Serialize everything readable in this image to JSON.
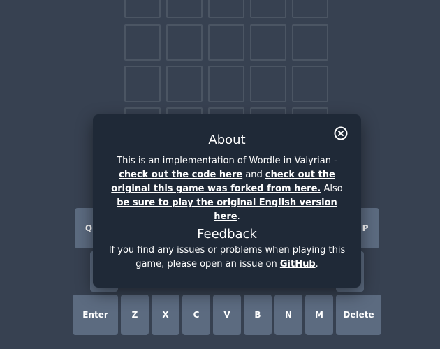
{
  "grid": {
    "visible_rows": 4,
    "columns": 5,
    "cells": [
      "",
      "",
      "",
      "",
      "",
      "",
      "",
      "",
      "",
      "",
      "",
      "",
      "",
      "",
      "",
      "",
      "",
      "",
      "",
      ""
    ]
  },
  "keyboard": {
    "row2_visible": [
      "Q",
      "P"
    ],
    "row4": [
      "Enter",
      "Z",
      "X",
      "C",
      "V",
      "B",
      "N",
      "M",
      "Delete"
    ]
  },
  "modal": {
    "title": "About",
    "about": {
      "text1": "This is an implementation of Wordle in Valyrian - ",
      "link_code": "check out the code here",
      "text2": " and ",
      "link_original": "check out the original this game was forked from here.",
      "text3": " Also ",
      "link_english": "be sure to play the original English version here",
      "text4": "."
    },
    "feedback_title": "Feedback",
    "feedback": {
      "text1": "If you find any issues or problems when playing this game, please open an issue on ",
      "link_github": "GitHub",
      "text2": "."
    },
    "close_icon": "circle-x-icon"
  },
  "colors": {
    "background": "#374151",
    "modal_bg": "#1f2937",
    "key_bg": "#5c6b80",
    "cell_border": "#4b5563"
  }
}
